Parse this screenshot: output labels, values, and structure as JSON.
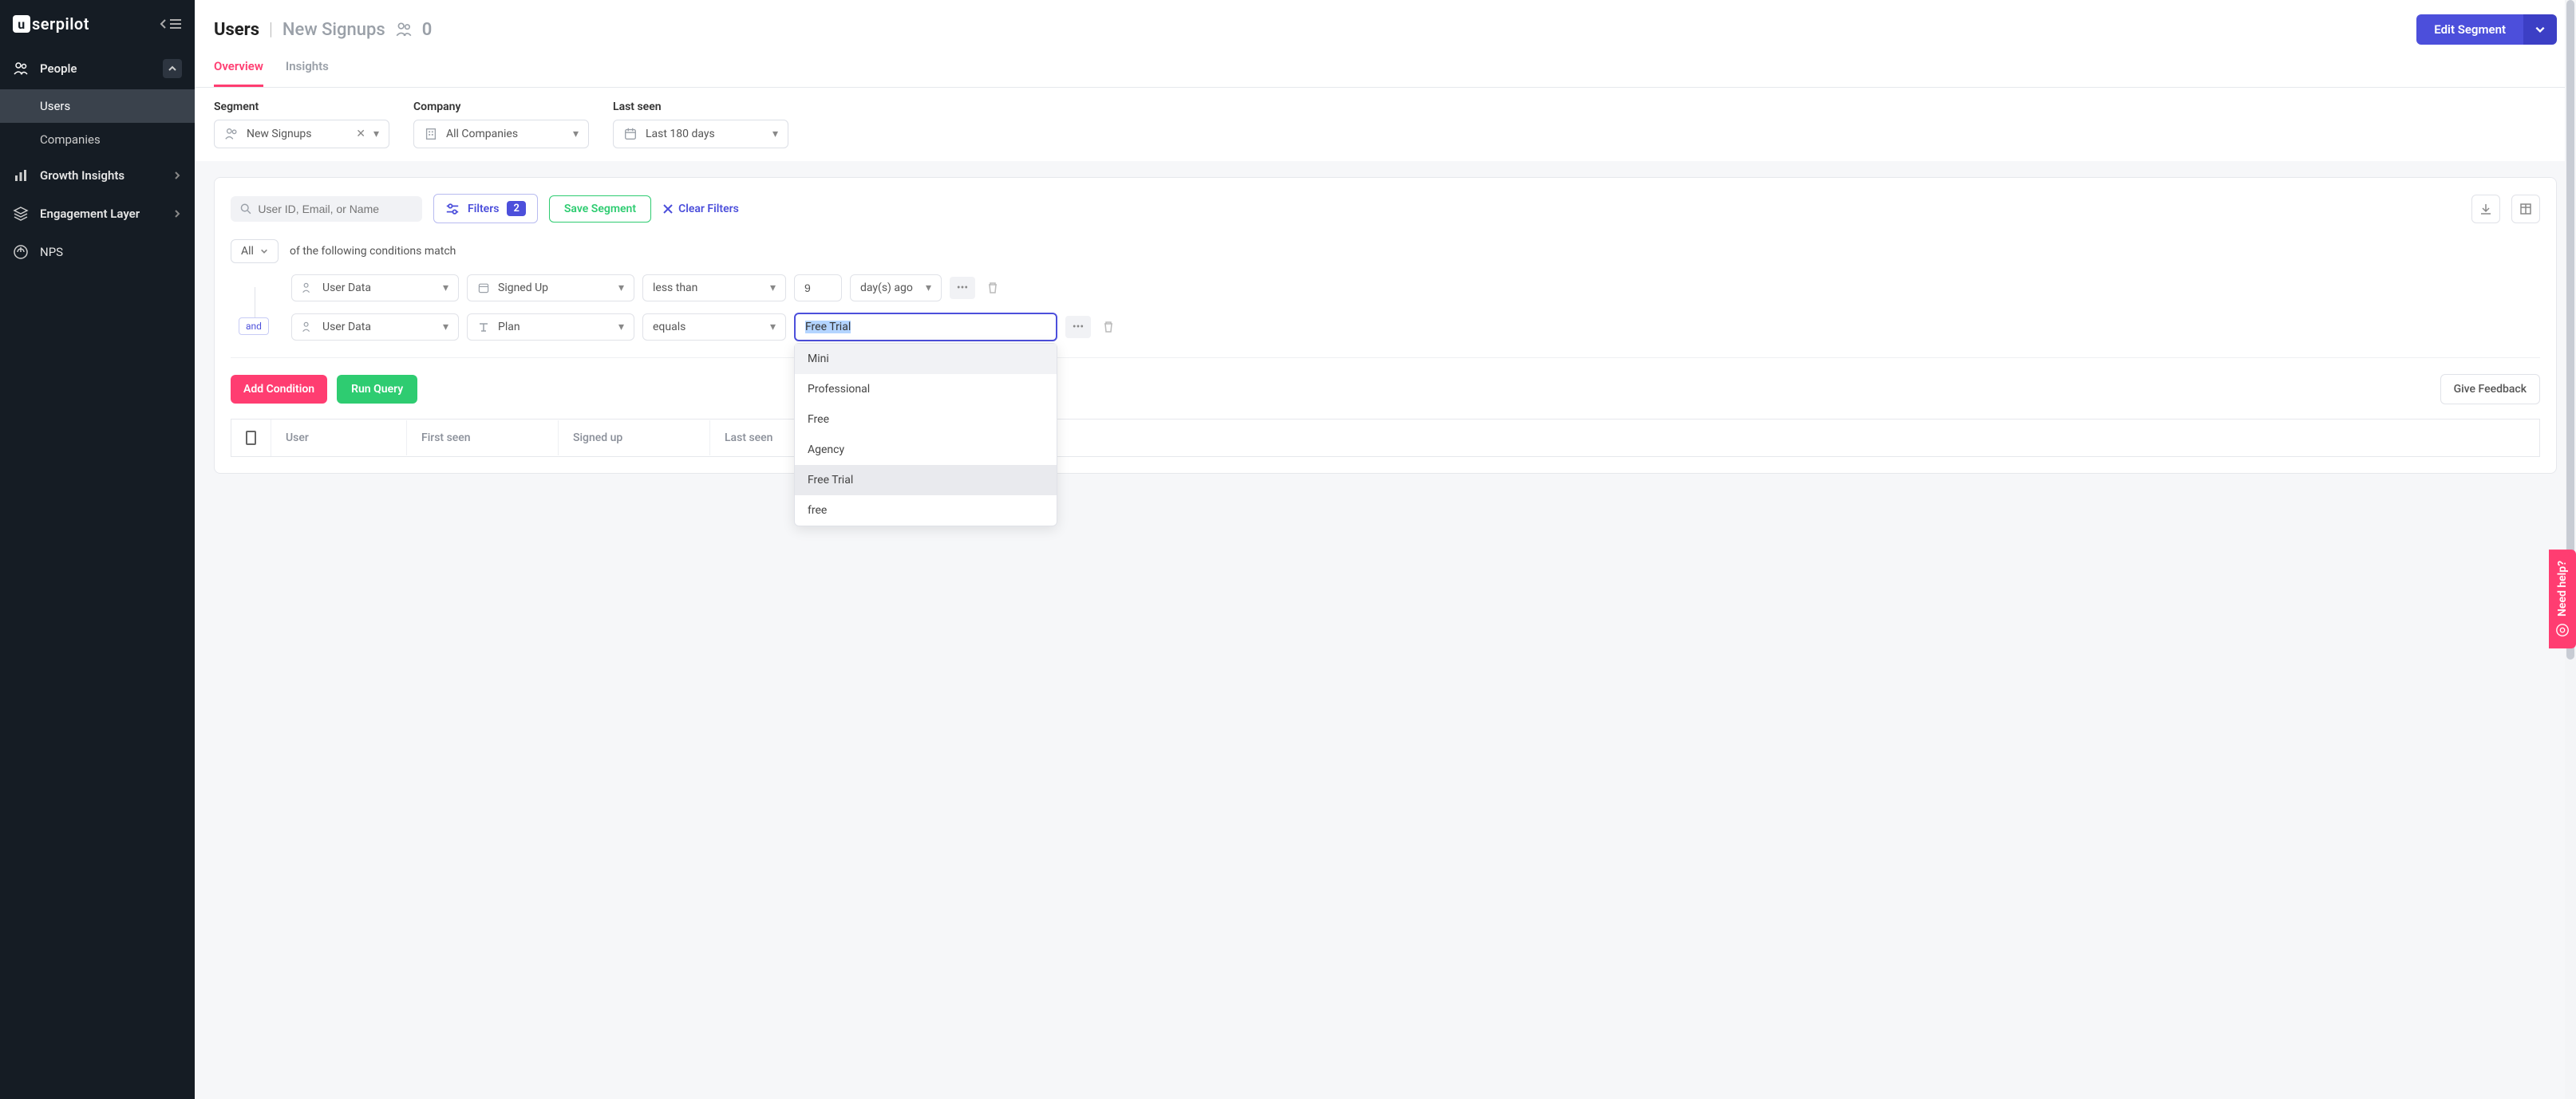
{
  "brand": "serpilot",
  "sidebar": {
    "people": {
      "label": "People",
      "expanded": true
    },
    "users": {
      "label": "Users"
    },
    "companies": {
      "label": "Companies"
    },
    "growth": {
      "label": "Growth Insights"
    },
    "engagement": {
      "label": "Engagement Layer"
    },
    "nps": {
      "label": "NPS"
    }
  },
  "header": {
    "title": "Users",
    "segment_name": "New Signups",
    "count": "0",
    "edit_segment": "Edit Segment"
  },
  "tabs": {
    "overview": "Overview",
    "insights": "Insights"
  },
  "filters": {
    "segment_label": "Segment",
    "segment_value": "New Signups",
    "company_label": "Company",
    "company_value": "All Companies",
    "lastseen_label": "Last seen",
    "lastseen_value": "Last 180 days"
  },
  "query": {
    "search_placeholder": "User ID, Email, or Name",
    "filters_label": "Filters",
    "filters_count": "2",
    "save_segment": "Save Segment",
    "clear_filters": "Clear Filters",
    "match_mode": "All",
    "match_text": "of the following conditions match",
    "row1": {
      "source": "User Data",
      "field": "Signed Up",
      "op": "less than",
      "value": "9",
      "unit": "day(s) ago"
    },
    "row2": {
      "connector": "and",
      "source": "User Data",
      "field": "Plan",
      "op": "equals",
      "value": "Free Trial"
    },
    "dropdown": {
      "opt1": "Mini",
      "opt2": "Professional",
      "opt3": "Free",
      "opt4": "Agency",
      "opt5": "Free Trial",
      "opt6": "free"
    },
    "add_condition": "Add Condition",
    "run_query": "Run Query",
    "give_feedback": "Give Feedback"
  },
  "table": {
    "col_user": "User",
    "col_first_seen": "First seen",
    "col_signed_up": "Signed up",
    "col_last_seen": "Last seen"
  },
  "help": "Need help?"
}
